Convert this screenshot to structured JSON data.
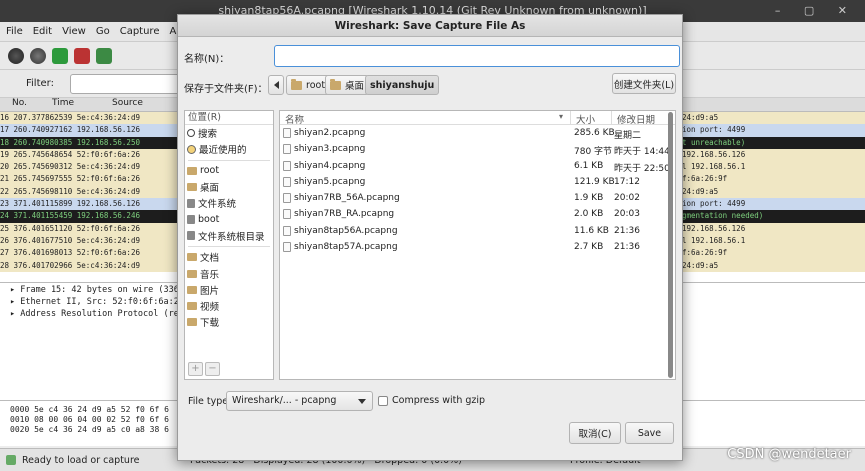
{
  "bg": {
    "title": "shiyan8tap56A.pcapng   [Wireshark 1.10.14  (Git Rev Unknown from unknown)]",
    "menu": [
      "File",
      "Edit",
      "View",
      "Go",
      "Capture",
      "Analyze"
    ],
    "filter_label": "Filter:",
    "columns": [
      "No.",
      "Time",
      "Source"
    ],
    "rows": [
      {
        "left": "16 207.377862539 5e:c4:36:24:d9",
        "right": "24:d9:a5",
        "style": "tan"
      },
      {
        "left": "17 260.740927162 192.168.56.126",
        "right": "ion port: 4499",
        "style": "blue"
      },
      {
        "left": "18 260.740980385 192.168.56.250",
        "right": "t unreachable)",
        "style": "dark"
      },
      {
        "left": "19 265.745648654 52:f0:6f:6a:26",
        "right": "192.168.56.126",
        "style": "tan"
      },
      {
        "left": "20 265.745690312 5e:c4:36:24:d9",
        "right": "l 192.168.56.1",
        "style": "tan"
      },
      {
        "left": "21 265.745697555 52:f0:6f:6a:26",
        "right": "f:6a:26:9f",
        "style": "tan"
      },
      {
        "left": "22 265.745698110 5e:c4:36:24:d9",
        "right": "24:d9:a5",
        "style": "tan"
      },
      {
        "left": "23 371.401115899 192.168.56.126",
        "right": "ion port: 4499",
        "style": "blue"
      },
      {
        "left": "24 371.401155459 192.168.56.246",
        "right": "gmentation needed)",
        "style": "dark"
      },
      {
        "left": "25 376.401651120 52:f0:6f:6a:26",
        "right": "192.168.56.126",
        "style": "tan"
      },
      {
        "left": "26 376.401677510 5e:c4:36:24:d9",
        "right": "l 192.168.56.1",
        "style": "tan"
      },
      {
        "left": "27 376.401698013 52:f0:6f:6a:26",
        "right": "f:6a:26:9f",
        "style": "tan"
      },
      {
        "left": "28 376.401702966 5e:c4:36:24:d9",
        "right": "24:d9:a5",
        "style": "tan"
      }
    ],
    "details": [
      "▸ Frame 15: 42 bytes on wire (336",
      "▸ Ethernet II, Src: 52:f0:6f:6a:26",
      "▸ Address Resolution Protocol (rep"
    ],
    "hex": [
      "0000  5e c4 36 24 d9 a5 52 f0  6f 6",
      "0010  08 00 06 04 00 02 52 f0  6f 6",
      "0020  5e c4 36 24 d9 a5 c0 a8  38 6"
    ],
    "status_ready": "Ready to load or capture",
    "status_packets": "Packets: 28 · Displayed: 28 (100.0%) · Dropped: 0 (0.0%)",
    "status_profile": "Profile: Default",
    "watermark": "CSDN @wendetaer"
  },
  "dialog": {
    "title": "Wireshark: Save Capture File As",
    "name_label": "名称(N)：",
    "name_value": "",
    "save_in_label": "保存于文件夹(F)：",
    "path": [
      "root",
      "桌面",
      "shiyanshuju"
    ],
    "create_folder": "创建文件夹(L)",
    "places_header": "位置(R)",
    "places": [
      {
        "label": "搜索",
        "icon": "search-icon"
      },
      {
        "label": "最近使用的",
        "icon": "clock-icon"
      },
      {
        "label": "root",
        "icon": "folder-icon"
      },
      {
        "label": "桌面",
        "icon": "folder-icon"
      },
      {
        "label": "文件系统",
        "icon": "drive-icon"
      },
      {
        "label": "boot",
        "icon": "drive-icon"
      },
      {
        "label": "文件系统根目录",
        "icon": "drive-icon"
      },
      {
        "label": "文档",
        "icon": "folder-icon"
      },
      {
        "label": "音乐",
        "icon": "folder-icon"
      },
      {
        "label": "图片",
        "icon": "folder-icon"
      },
      {
        "label": "视频",
        "icon": "folder-icon"
      },
      {
        "label": "下载",
        "icon": "folder-icon"
      }
    ],
    "columns": {
      "name": "名称",
      "size": "大小",
      "modified": "修改日期"
    },
    "files": [
      {
        "name": "shiyan2.pcapng",
        "size": "285.6 KB",
        "date": "星期二"
      },
      {
        "name": "shiyan3.pcapng",
        "size": "780 字节",
        "date": "昨天于 14:44"
      },
      {
        "name": "shiyan4.pcapng",
        "size": "6.1 KB",
        "date": "昨天于 22:50"
      },
      {
        "name": "shiyan5.pcapng",
        "size": "121.9 KB",
        "date": "17:12"
      },
      {
        "name": "shiyan7RB_56A.pcapng",
        "size": "1.9 KB",
        "date": "20:02"
      },
      {
        "name": "shiyan7RB_RA.pcapng",
        "size": "2.0 KB",
        "date": "20:03"
      },
      {
        "name": "shiyan8tap56A.pcapng",
        "size": "11.6 KB",
        "date": "21:36"
      },
      {
        "name": "shiyan8tap57A.pcapng",
        "size": "2.7 KB",
        "date": "21:36"
      }
    ],
    "file_type_label": "File type:",
    "file_type_value": "Wireshark/... - pcapng",
    "gzip_label": "Compress with gzip",
    "cancel": "取消(C)",
    "save": "Save"
  }
}
